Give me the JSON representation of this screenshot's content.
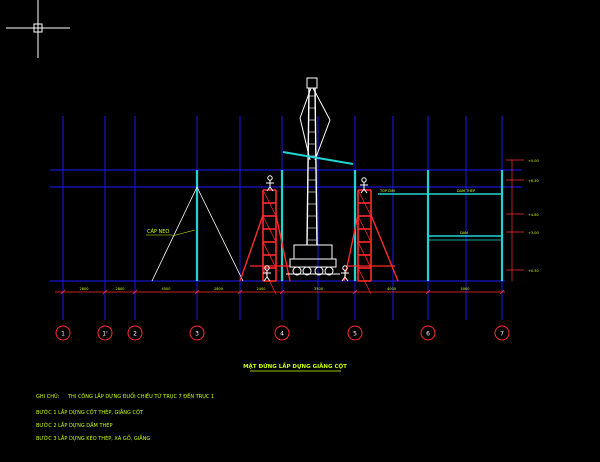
{
  "colors": {
    "background": "#000000",
    "grid_line": "#1c1cff",
    "column": "#22d3d3",
    "scaffold": "#ff2a2a",
    "crane": "#ffffff",
    "dimension": "#ff3030",
    "axis_bubble": "#ff2a2a",
    "annotation": "#c8ff00",
    "cable": "#ffffff",
    "beam": "#22d3d3"
  },
  "cursor_icon": "crosshair-cursor-icon",
  "axes": [
    "1",
    "1'",
    "2",
    "3",
    "4",
    "5",
    "6",
    "7"
  ],
  "dimensions": [
    "2800",
    "2800",
    "4500",
    "2800",
    "2400",
    "3500",
    "4000",
    "5000"
  ],
  "level_labels": [
    "+0.00",
    "+6.50",
    "+4.60",
    "+3.00",
    "+0.50"
  ],
  "labels": {
    "cap_neo": "CÁP NEO",
    "beam_top_left": "TOP DIM",
    "beam_top_right": "DAM THEP",
    "beam_mid": "DAM"
  },
  "drawing_title": "MẶT ĐỨNG LẮP DỰNG GIẰNG CỘT",
  "notes": {
    "header_label": "GHI CHÚ:",
    "header_text": "THI CÔNG LẮP DỰNG ĐUỔI CHIỀU TỪ TRỤC 7 ĐẾN TRỤC 1",
    "steps": [
      "BƯỚC 1 LẮP DỰNG CỘT THÉP, GIẰNG CỘT",
      "BƯỚC 2 LẮP DỰNG DẦM THÉP",
      "BƯỚC 3 LẮP DỰNG KÈO THÉP, XÀ GỒ, GIẰNG"
    ]
  }
}
